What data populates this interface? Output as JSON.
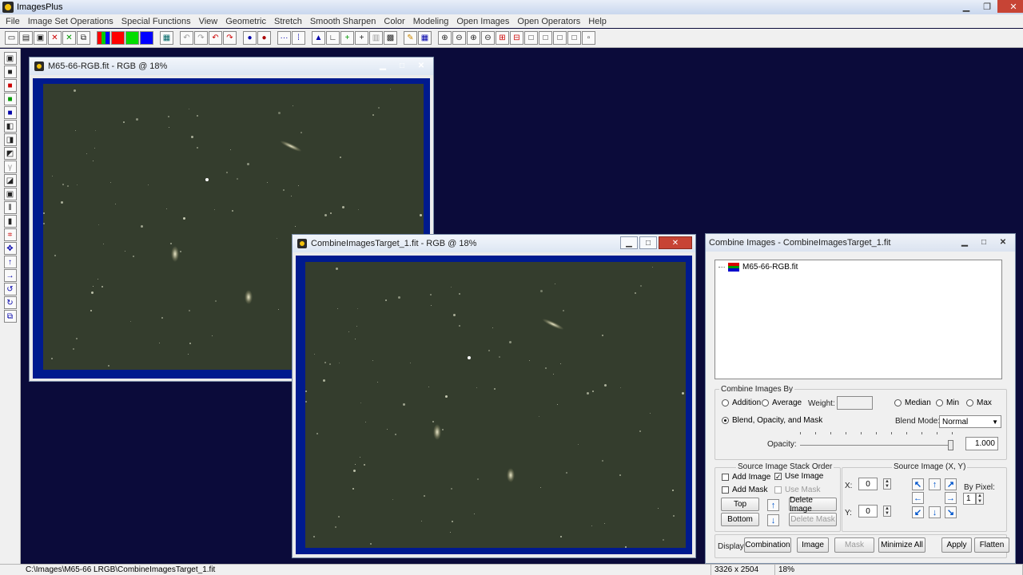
{
  "app": {
    "title": "ImagesPlus"
  },
  "menubar": [
    "File",
    "Image Set Operations",
    "Special Functions",
    "View",
    "Geometric",
    "Stretch",
    "Smooth Sharpen",
    "Color",
    "Modeling",
    "Open Images",
    "Open Operators",
    "Help"
  ],
  "windows": {
    "m65": {
      "title": "M65-66-RGB.fit - RGB @ 18%"
    },
    "target": {
      "title": "CombineImagesTarget_1.fit - RGB @ 18%"
    }
  },
  "dialog": {
    "title": "Combine Images - CombineImagesTarget_1.fit",
    "list_items": [
      "M65-66-RGB.fit"
    ],
    "combine_by": {
      "label": "Combine Images By",
      "addition": "Addition",
      "average": "Average",
      "weight_label": "Weight:",
      "weight_value": "",
      "median": "Median",
      "min": "Min",
      "max": "Max",
      "blend": "Blend, Opacity, and Mask",
      "blend_mode_label": "Blend Mode:",
      "blend_mode_value": "Normal",
      "opacity_label": "Opacity:",
      "opacity_value": "1.000",
      "opacity_level": 1.0
    },
    "stack_order": {
      "label": "Source Image Stack Order",
      "add_image": "Add Image",
      "use_image": "Use Image",
      "add_mask": "Add Mask",
      "use_mask": "Use Mask",
      "top": "Top",
      "bottom": "Bottom",
      "delete_image": "Delete Image",
      "delete_mask": "Delete Mask"
    },
    "source_xy": {
      "label": "Source Image (X, Y)",
      "x_label": "X:",
      "x_value": "0",
      "y_label": "Y:",
      "y_value": "0",
      "by_pixel_label": "By Pixel:",
      "by_pixel_value": "1"
    },
    "display": {
      "label": "Display:",
      "combination": "Combination",
      "image": "Image",
      "mask": "Mask",
      "minimize_all": "Minimize All",
      "apply": "Apply",
      "flatten": "Flatten"
    }
  },
  "statusbar": {
    "path": "C:\\Images\\M65-66 LRGB\\CombineImagesTarget_1.fit",
    "dims": "3326 x 2504",
    "zoom": "18%"
  }
}
